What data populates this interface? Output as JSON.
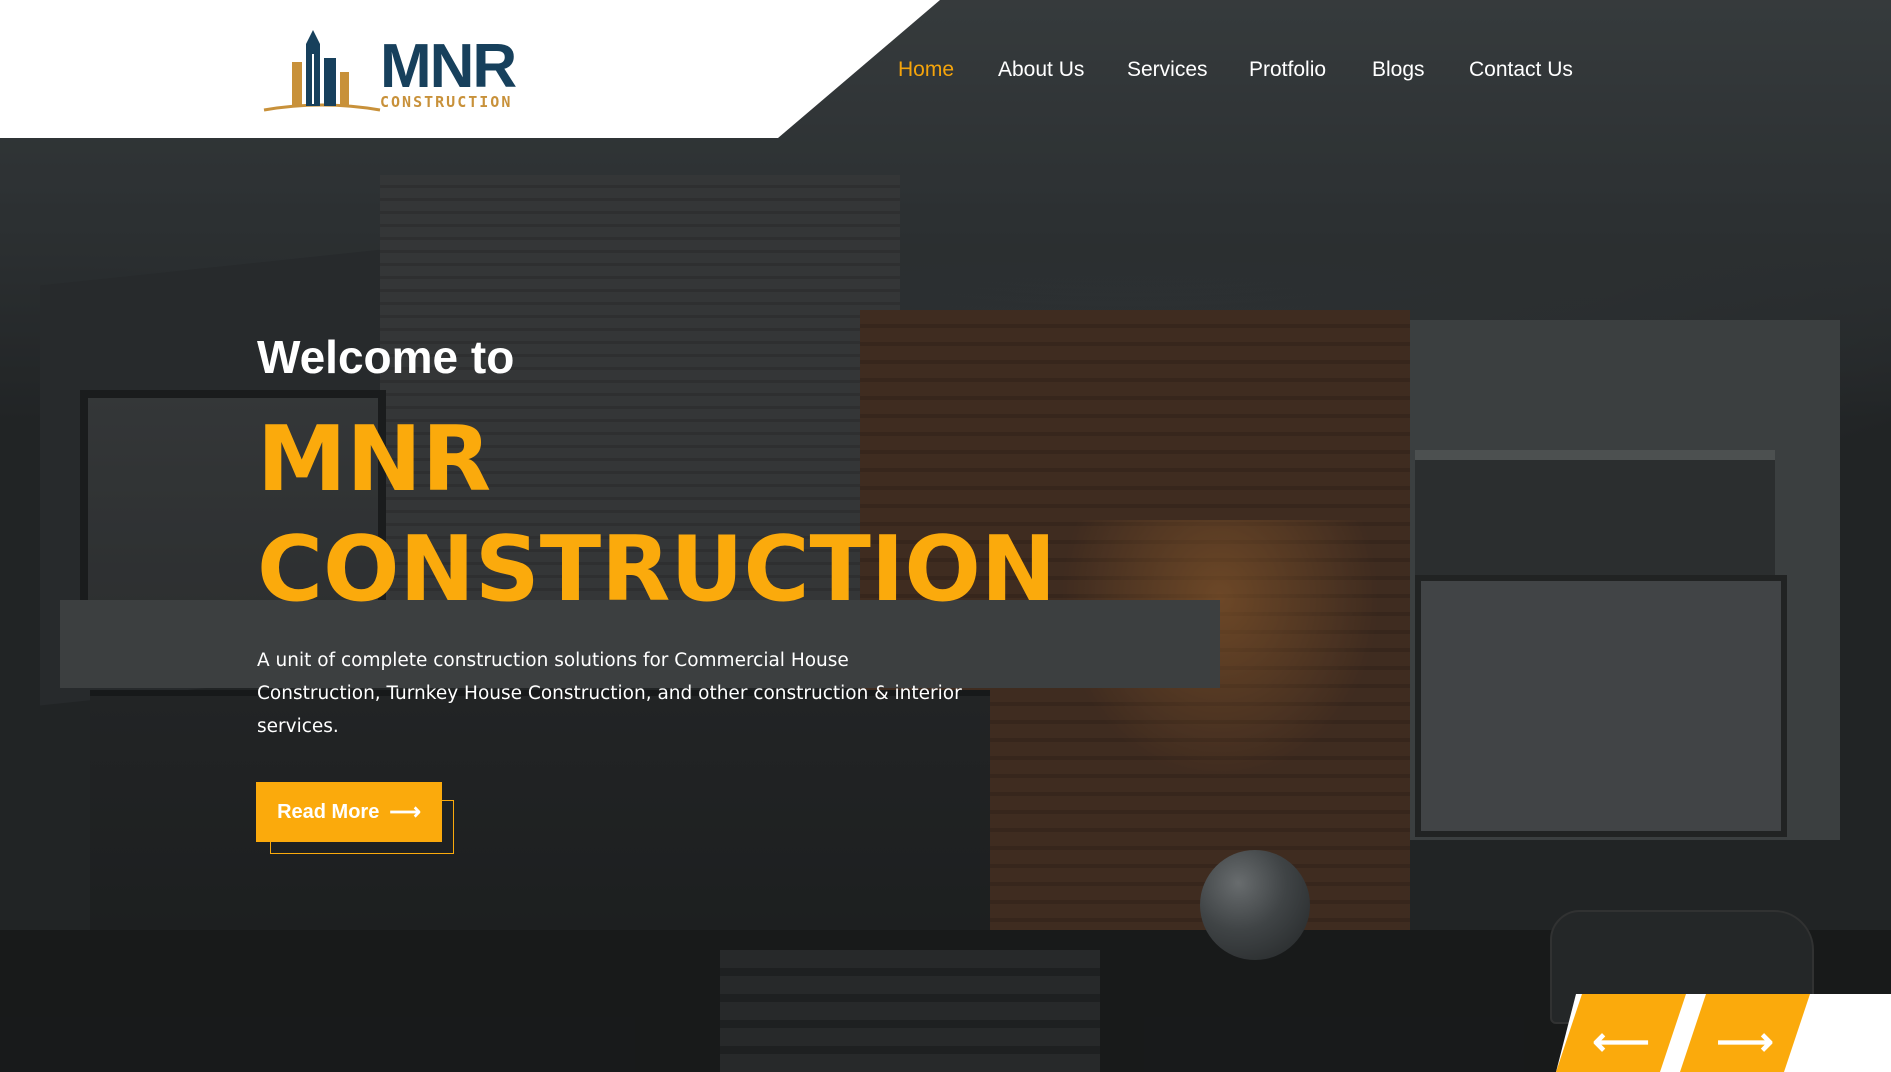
{
  "logo": {
    "brand": "MNR",
    "subtitle": "CONSTRUCTION"
  },
  "nav": [
    {
      "label": "Home",
      "active": true
    },
    {
      "label": "About Us",
      "active": false
    },
    {
      "label": "Services",
      "active": false
    },
    {
      "label": "Protfolio",
      "active": false
    },
    {
      "label": "Blogs",
      "active": false
    },
    {
      "label": "Contact Us",
      "active": false
    }
  ],
  "hero": {
    "welcome": "Welcome to",
    "title_line1": "MNR",
    "title_line2": "CONSTRUCTION",
    "description": "A unit of complete construction solutions for Commercial House Construction, Turnkey House Construction, and other construction & interior services.",
    "button_label": "Read More",
    "button_icon": "arrow-right-icon"
  },
  "slider": {
    "prev_icon": "arrow-left-icon",
    "next_icon": "arrow-right-icon",
    "prev_glyph": "⟵",
    "next_glyph": "⟶"
  },
  "colors": {
    "accent": "#fbaa0c",
    "brand_navy": "#17405c",
    "brand_gold": "#c8913a",
    "header_bg": "#ffffff"
  }
}
